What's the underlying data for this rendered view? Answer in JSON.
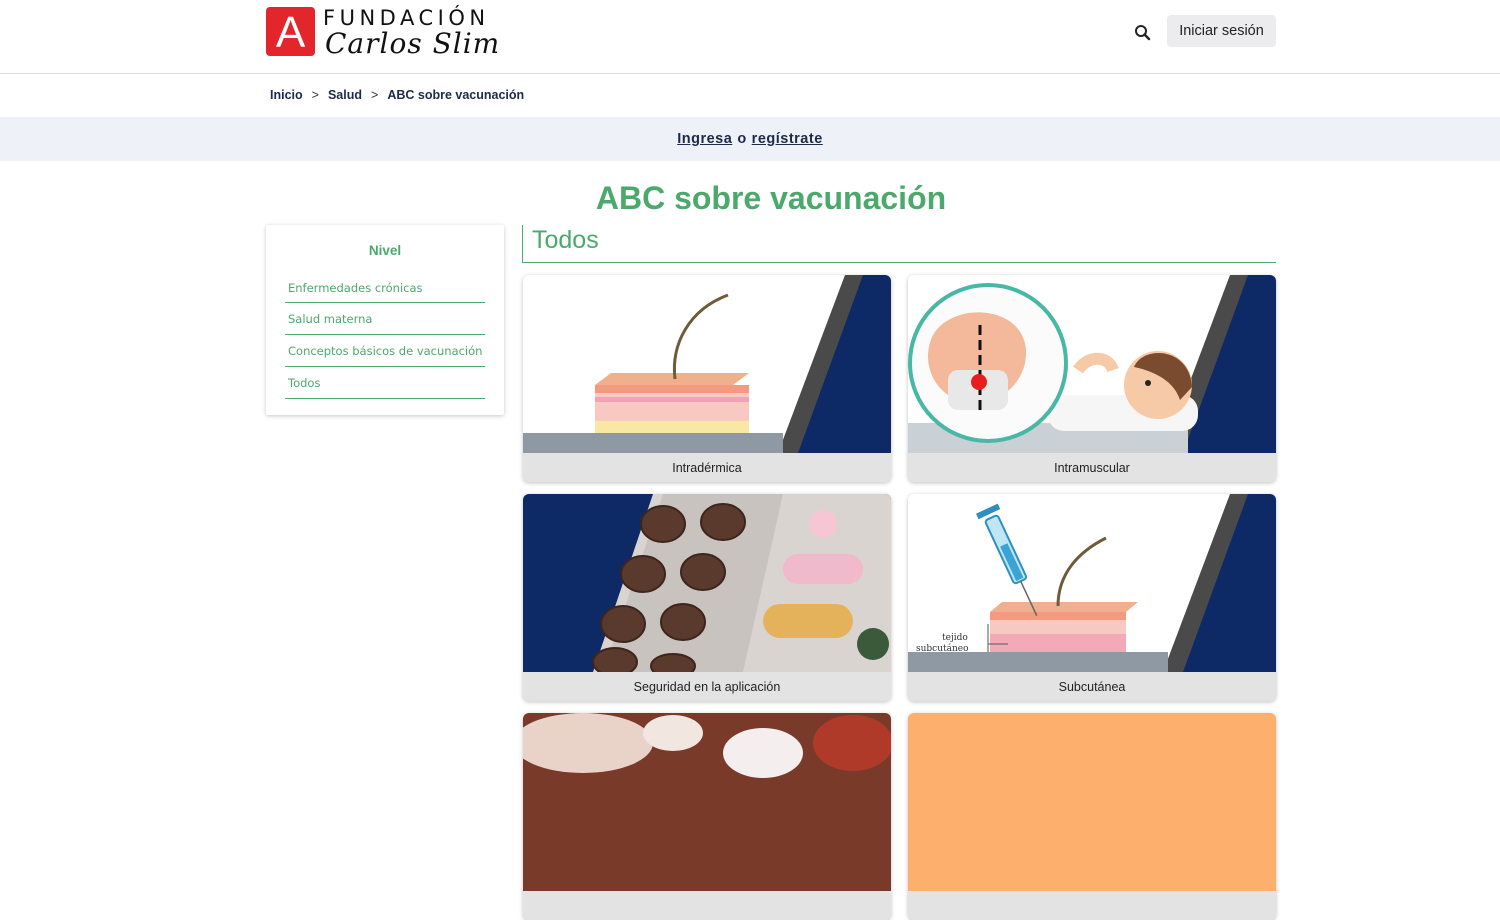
{
  "header": {
    "logo_letter": "A",
    "logo_line1": "FUNDACIÓN",
    "logo_line2": "Carlos Slim",
    "search_icon": "search-icon",
    "login_label": "Iniciar sesión"
  },
  "breadcrumb": {
    "items": [
      "Inicio",
      "Salud",
      "ABC sobre vacunación"
    ],
    "separator": ">"
  },
  "banner": {
    "login_link": "Ingresa",
    "or": "o",
    "register_link": "regístrate"
  },
  "page": {
    "title": "ABC sobre vacunación",
    "section_title": "Todos"
  },
  "sidebar": {
    "title": "Nivel",
    "items": [
      {
        "label": "Enfermedades crónicas"
      },
      {
        "label": "Salud materna"
      },
      {
        "label": "Conceptos básicos de vacunación"
      },
      {
        "label": "Todos"
      }
    ]
  },
  "cards": [
    {
      "label": "Intradérmica"
    },
    {
      "label": "Intramuscular"
    },
    {
      "label": "Seguridad en la aplicación"
    },
    {
      "label": "Subcutánea",
      "image_text_line1": "tejido",
      "image_text_line2": "subcutáneo"
    },
    {
      "label": ""
    },
    {
      "label": ""
    }
  ],
  "colors": {
    "brand_red": "#e3252c",
    "accent_green": "#4ba96b",
    "navy": "#1d2a4a",
    "banner_bg": "#eef1f7"
  }
}
